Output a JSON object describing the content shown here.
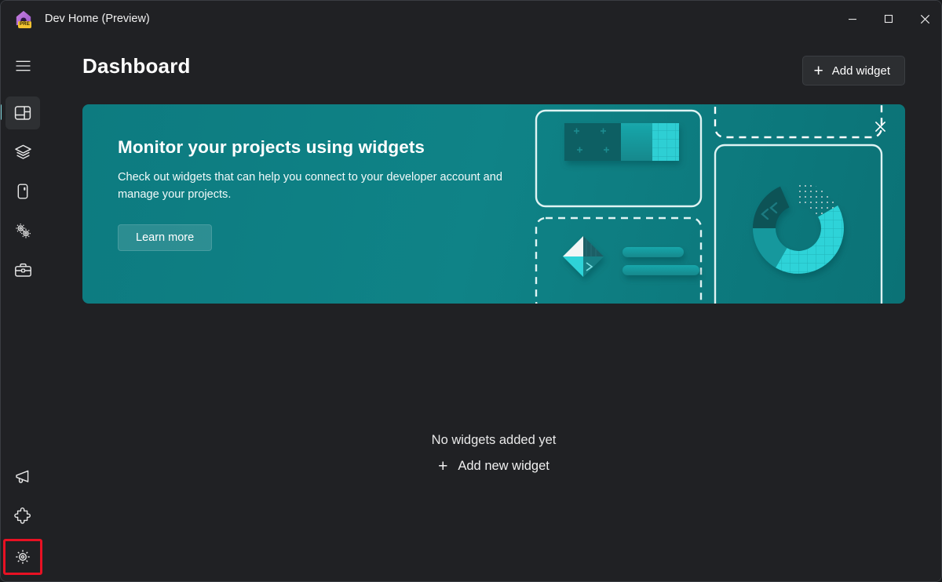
{
  "window": {
    "app_title": "Dev Home (Preview)",
    "icon_badge": "PRE",
    "app_icon_name": "dev-home-house-icon",
    "controls": {
      "minimize": "—",
      "maximize": "□",
      "close": "✕"
    }
  },
  "sidebar": {
    "items": [
      {
        "icon": "hamburger-menu-icon",
        "name": "menu"
      },
      {
        "icon": "dashboard-icon",
        "name": "dashboard",
        "selected": true
      },
      {
        "icon": "layers-icon",
        "name": "machine-configuration"
      },
      {
        "icon": "device-icon",
        "name": "environments"
      },
      {
        "icon": "gears-icon",
        "name": "utilities"
      },
      {
        "icon": "toolbox-icon",
        "name": "dev-toolbox"
      }
    ],
    "bottom_items": [
      {
        "icon": "megaphone-icon",
        "name": "feedback"
      },
      {
        "icon": "puzzle-icon",
        "name": "extensions"
      },
      {
        "icon": "gear-icon",
        "name": "settings",
        "highlighted": true
      }
    ],
    "highlight_color": "#e81123",
    "selection_indicator_color": "#7fd4db"
  },
  "header": {
    "title": "Dashboard",
    "add_widget_label": "Add widget",
    "add_widget_icon": "plus-icon"
  },
  "banner": {
    "title": "Monitor your projects using widgets",
    "body": "Check out widgets that can help you connect to your developer account and manage your projects.",
    "learn_more_label": "Learn more",
    "close_icon": "close-icon",
    "background_color": "#0f8387",
    "illustration": {
      "name": "widgets-illustration",
      "donut_segments": [
        "white-dotted",
        "dark-teal-chevron",
        "mid-teal",
        "cyan-grid"
      ]
    }
  },
  "empty_state": {
    "title": "No widgets added yet",
    "action_label": "Add new widget",
    "action_icon": "plus-icon"
  }
}
